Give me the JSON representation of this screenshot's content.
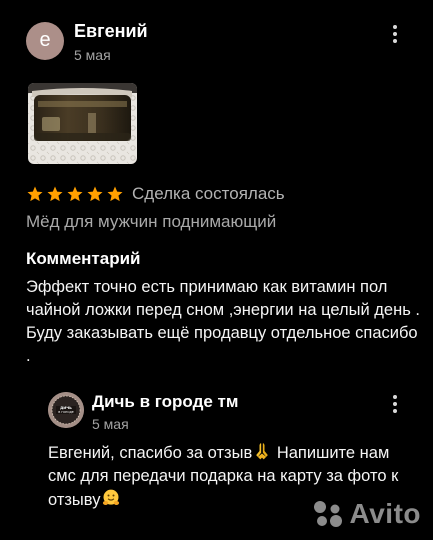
{
  "review": {
    "author": {
      "initial": "е",
      "name": "Евгений",
      "date": "5 мая"
    },
    "rating": 5,
    "deal_status": "Сделка состоялась",
    "item_name": "Мёд для мужчин поднимающий",
    "comment_label": "Комментарий",
    "comment_text": "Эффект точно есть принимаю как витамин пол чайной ложки перед сном ,энергии на целый день . Буду заказывать ещё продавцу отдельное спасибо ."
  },
  "reply": {
    "author": {
      "name": "Дичь в городе тм",
      "date": "5 мая",
      "avatar_text": "ДИЧЬ В ГОРОДЕ"
    },
    "text_part1": "Евгений, спасибо за отзыв",
    "text_part2": " Напишите нам смс для передачи подарка на карту за фото к отзыву",
    "emoji_1": "folded-hands",
    "emoji_2": "hugging-face"
  },
  "watermark": {
    "text": "Avito"
  },
  "colors": {
    "background": "#000000",
    "star": "#ffa000",
    "avatar": "#ac8f89",
    "muted_text": "#a3a3a3"
  }
}
